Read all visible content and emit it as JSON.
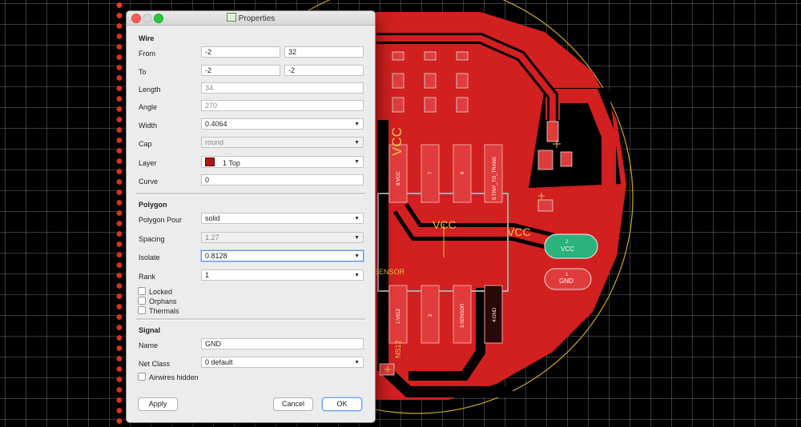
{
  "window": {
    "title": "Properties"
  },
  "wire": {
    "heading": "Wire",
    "from": {
      "label": "From",
      "x": "-2",
      "y": "32"
    },
    "to": {
      "label": "To",
      "x": "-2",
      "y": "-2"
    },
    "length": {
      "label": "Length",
      "value": "34"
    },
    "angle": {
      "label": "Angle",
      "value": "270"
    },
    "width": {
      "label": "Width",
      "value": "0.4064"
    },
    "cap": {
      "label": "Cap",
      "value": "round"
    },
    "layer": {
      "label": "Layer",
      "value": "1 Top",
      "color": "#b01818"
    },
    "curve": {
      "label": "Curve",
      "value": "0"
    }
  },
  "polygon": {
    "heading": "Polygon",
    "pour": {
      "label": "Polygon Pour",
      "value": "solid"
    },
    "spacing": {
      "label": "Spacing",
      "value": "1.27"
    },
    "isolate": {
      "label": "Isolate",
      "value": "0.8128"
    },
    "rank": {
      "label": "Rank",
      "value": "1"
    },
    "locked": "Locked",
    "orphans": "Orphans",
    "thermals": "Thermals"
  },
  "signal": {
    "heading": "Signal",
    "name": {
      "label": "Name",
      "value": "GND"
    },
    "net_class": {
      "label": "Net Class",
      "value": "0 default"
    },
    "airwires_hidden": "Airwires hidden"
  },
  "buttons": {
    "apply": "Apply",
    "cancel": "Cancel",
    "ok": "OK"
  },
  "pcb": {
    "labels": {
      "vcc_big": "VCC",
      "vcc_mid": "VCC",
      "vcc_right": "VCC",
      "pad_vcc": "VCC",
      "pad_gnd": "GND",
      "sensor": "SENSOR",
      "ns12": "NS12",
      "pad_8vcc": "8:VCC",
      "pad_7": "7",
      "pad_6": "6",
      "pad_5": "5:TINY_TO_TRANS",
      "pad_1v": "1:V812",
      "pad_2": "2",
      "pad_3": "3:SENSOR",
      "pad_4": "4:GND",
      "pad_num_2": "2",
      "pad_num_1": "1"
    },
    "colors": {
      "copper": "#d21f1f",
      "silk": "#e6c34a",
      "outline": "#c9a52a"
    }
  }
}
